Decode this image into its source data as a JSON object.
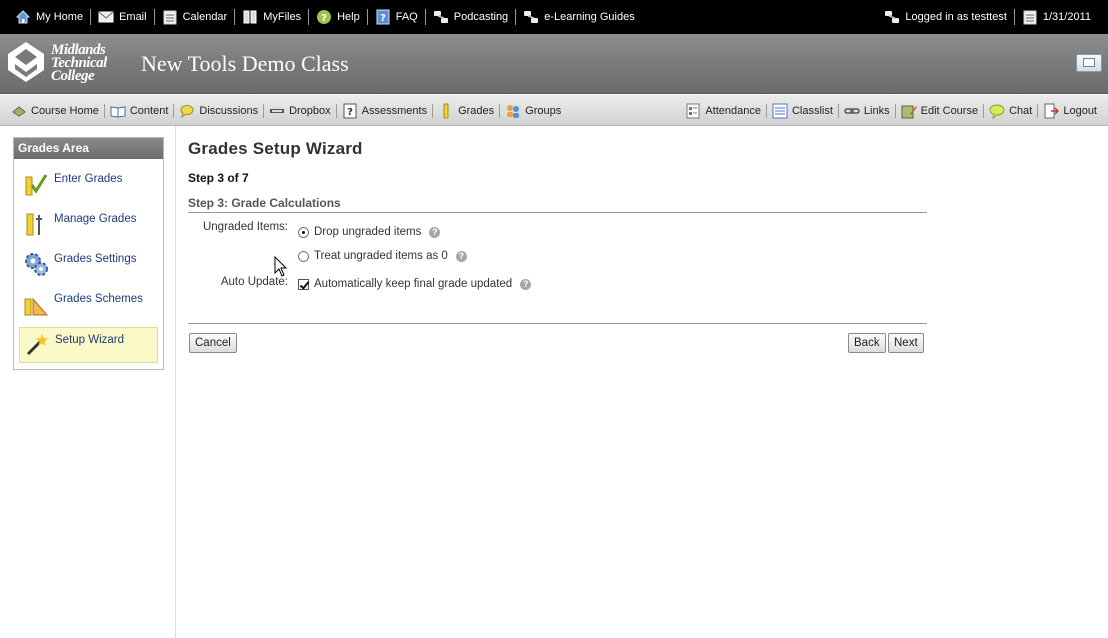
{
  "topbar": {
    "items": [
      {
        "label": "My Home",
        "icon": "home-icon"
      },
      {
        "label": "Email",
        "icon": "email-icon"
      },
      {
        "label": "Calendar",
        "icon": "calendar-icon"
      },
      {
        "label": "MyFiles",
        "icon": "files-icon"
      },
      {
        "label": "Help",
        "icon": "help-icon"
      },
      {
        "label": "FAQ",
        "icon": "faq-icon"
      },
      {
        "label": "Podcasting",
        "icon": "link-icon"
      },
      {
        "label": "e-Learning Guides",
        "icon": "link-icon"
      }
    ],
    "logged_in": "Logged in as testtest",
    "date": "1/31/2011"
  },
  "banner": {
    "logo_lines": [
      "Midlands",
      "Technical",
      "College"
    ],
    "course_title": "New Tools Demo Class"
  },
  "nav": {
    "left": [
      {
        "label": "Course Home",
        "icon": "course-home-icon"
      },
      {
        "label": "Content",
        "icon": "book-icon"
      },
      {
        "label": "Discussions",
        "icon": "discussion-icon"
      },
      {
        "label": "Dropbox",
        "icon": "dropbox-icon"
      },
      {
        "label": "Assessments",
        "icon": "quiz-icon"
      },
      {
        "label": "Grades",
        "icon": "ruler-icon"
      },
      {
        "label": "Groups",
        "icon": "groups-icon"
      }
    ],
    "right": [
      {
        "label": "Attendance",
        "icon": "attendance-icon"
      },
      {
        "label": "Classlist",
        "icon": "classlist-icon"
      },
      {
        "label": "Links",
        "icon": "chain-link-icon"
      },
      {
        "label": "Edit Course",
        "icon": "edit-course-icon"
      },
      {
        "label": "Chat",
        "icon": "chat-icon"
      },
      {
        "label": "Logout",
        "icon": "logout-icon"
      }
    ]
  },
  "sidebar": {
    "heading": "Grades Area",
    "items": [
      {
        "label": "Enter Grades",
        "icon": "enter-grades-icon"
      },
      {
        "label": "Manage Grades",
        "icon": "manage-grades-icon"
      },
      {
        "label": "Grades Settings",
        "icon": "gears-icon"
      },
      {
        "label": "Grades Schemes",
        "icon": "schemes-icon"
      },
      {
        "label": "Setup Wizard",
        "icon": "wand-icon",
        "active": true
      }
    ]
  },
  "main": {
    "title": "Grades Setup Wizard",
    "step_count": "Step 3 of 7",
    "step_heading": "Step 3: Grade Calculations",
    "ungraded_label": "Ungraded Items:",
    "ungraded_options": [
      {
        "label": "Drop ungraded items",
        "selected": true
      },
      {
        "label": "Treat ungraded items as 0",
        "selected": false
      }
    ],
    "auto_update_label": "Auto Update:",
    "auto_update_option": {
      "label": "Automatically keep final grade updated",
      "checked": true
    },
    "help_glyph": "?",
    "buttons": {
      "cancel": "Cancel",
      "back": "Back",
      "next": "Next"
    }
  }
}
